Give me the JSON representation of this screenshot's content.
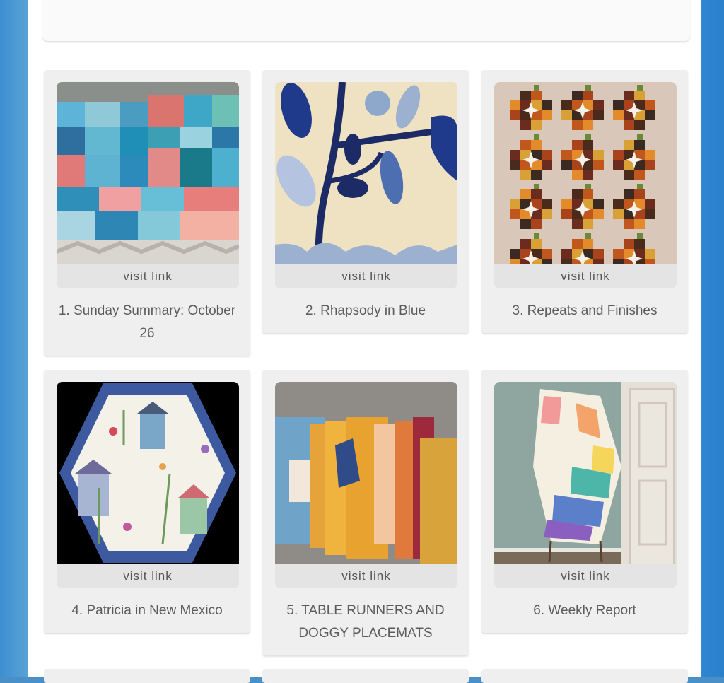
{
  "link_label": "visit link",
  "entries": [
    {
      "title": "1. Sunday Summary: October 26"
    },
    {
      "title": "2. Rhapsody in Blue"
    },
    {
      "title": "3. Repeats and Finishes"
    },
    {
      "title": "4. Patricia in New Mexico"
    },
    {
      "title": "5. TABLE RUNNERS AND DOGGY PLACEMATS"
    },
    {
      "title": "6. Weekly Report"
    }
  ],
  "colors": {
    "frame_blue": "#4a90c8",
    "card_bg": "#efefef",
    "caption_text": "#5c5c5c"
  }
}
